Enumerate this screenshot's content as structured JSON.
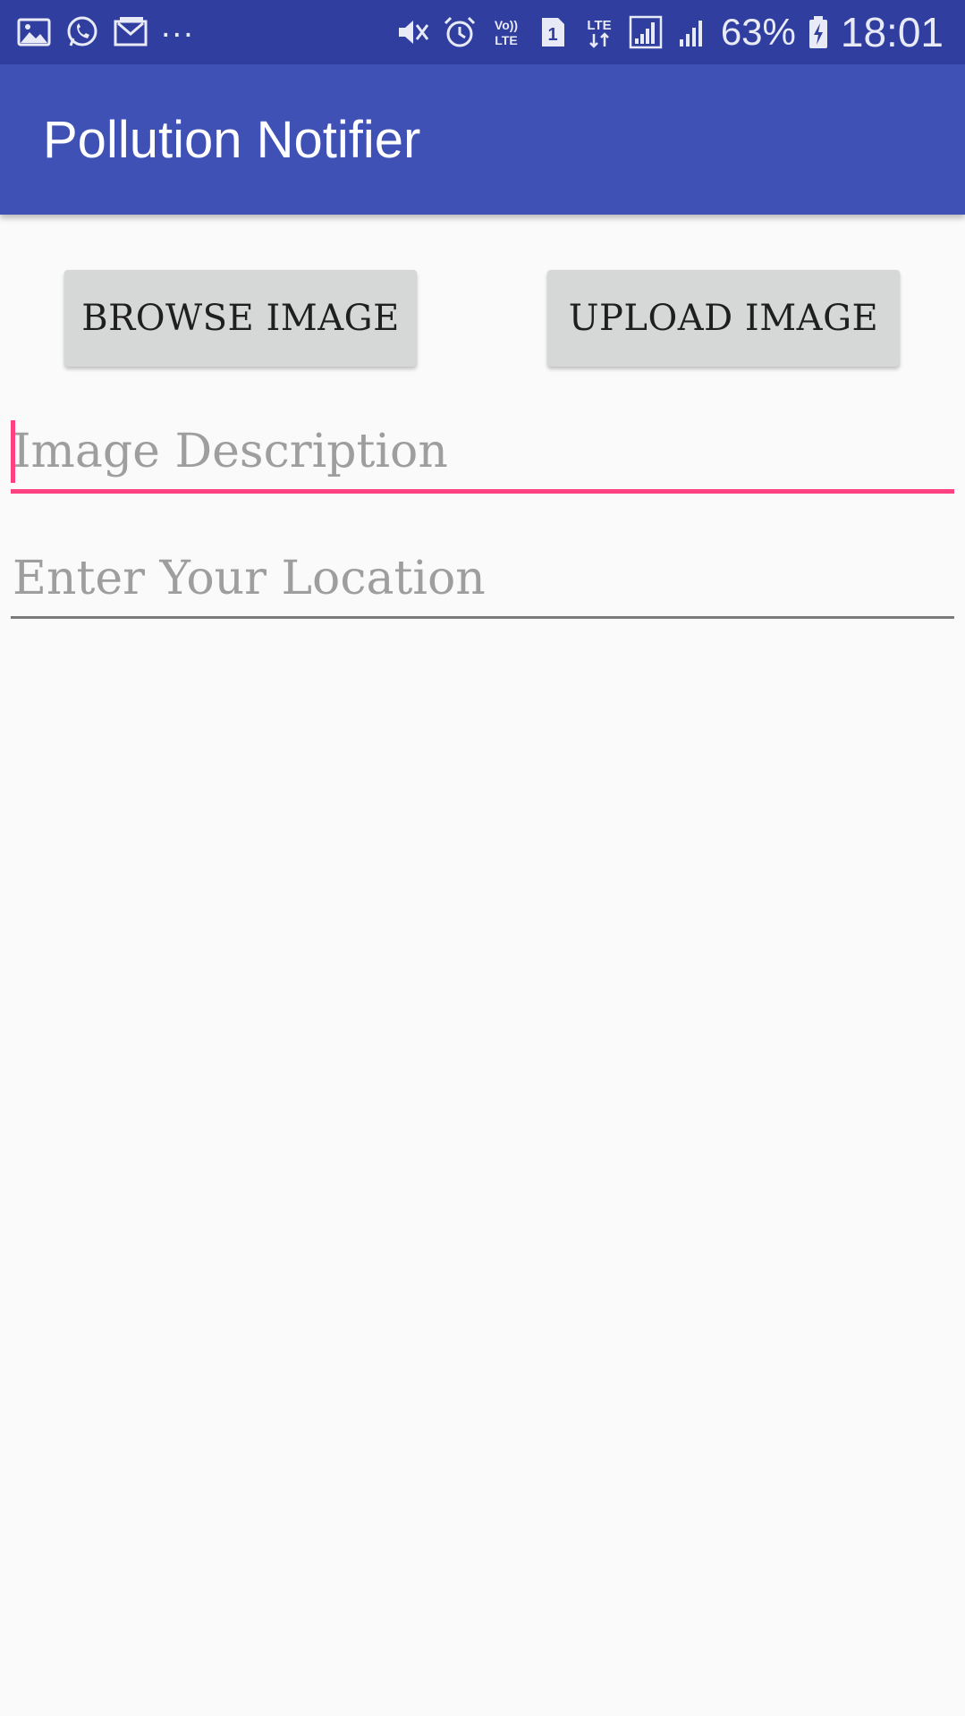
{
  "status_bar": {
    "left_icons": [
      "gallery-icon",
      "whatsapp-icon",
      "gmail-icon"
    ],
    "overflow": "...",
    "right_icons": [
      "mute-icon",
      "alarm-icon",
      "volte-icon",
      "sim-1-icon",
      "lte-icon",
      "signal-icon",
      "signal-2-icon",
      "battery-charging-icon"
    ],
    "volte_label": "Vo)) LTE",
    "sim_label": "1",
    "lte_label": "LTE",
    "battery": "63%",
    "time": "18:01"
  },
  "app_bar": {
    "title": "Pollution Notifier",
    "color": "#3f51b5"
  },
  "buttons": {
    "browse_label": "BROWSE IMAGE",
    "upload_label": "UPLOAD IMAGE"
  },
  "form": {
    "description": {
      "value": "",
      "placeholder": "Image Description",
      "focused": true
    },
    "location": {
      "value": "",
      "placeholder": "Enter Your Location",
      "focused": false
    }
  },
  "colors": {
    "status_bar": "#303f9f",
    "accent": "#ff4081",
    "background": "#fafafa"
  }
}
